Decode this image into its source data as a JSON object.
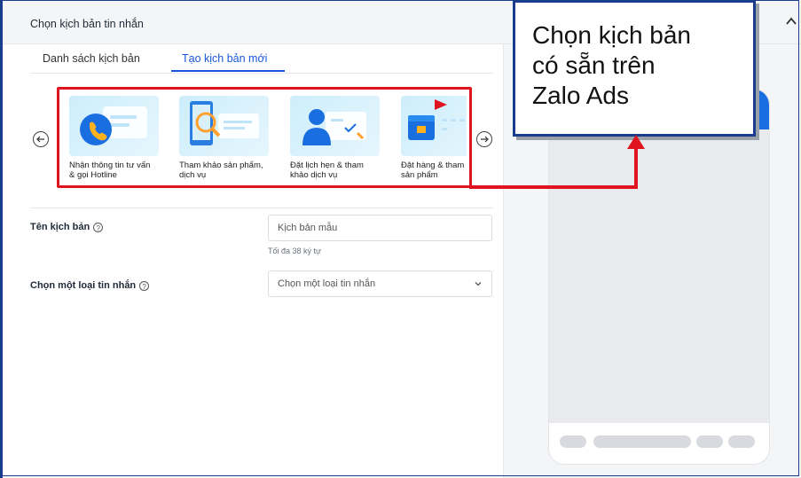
{
  "panel": {
    "title": "Chọn kịch bản tin nhắn"
  },
  "tabs": [
    {
      "label": "Danh sách kịch bản"
    },
    {
      "label": "Tạo kịch bản mới"
    }
  ],
  "carousel": {
    "items": [
      {
        "label": "Nhận thông tin tư vấn\n& gọi Hotline",
        "icon": "phone-call-icon"
      },
      {
        "label": "Tham khảo sản phẩm,\ndịch vụ",
        "icon": "magnifier-document-icon"
      },
      {
        "label": "Đặt lịch hẹn & tham\nkhảo dịch vụ",
        "icon": "person-calendar-icon"
      },
      {
        "label": "Đặt hàng & tham\nsản phẩm",
        "icon": "shop-cart-icon"
      }
    ]
  },
  "form": {
    "scenario_name_label": "Tên kịch bản",
    "scenario_name_placeholder": "Kịch bản mẫu",
    "scenario_name_hint": "Tối đa 38 ký tự",
    "message_type_label": "Chọn một loại tin nhắn",
    "message_type_value": "Chọn một loại tin nhắn"
  },
  "annotation": {
    "callout_text": "Chọn kịch bản\ncó sẵn trên\nZalo Ads",
    "highlight_color": "#e0141e",
    "border_color": "#1a3c8c"
  },
  "colors": {
    "accent": "#1a56db",
    "phone_header": "#1a6fe0"
  }
}
